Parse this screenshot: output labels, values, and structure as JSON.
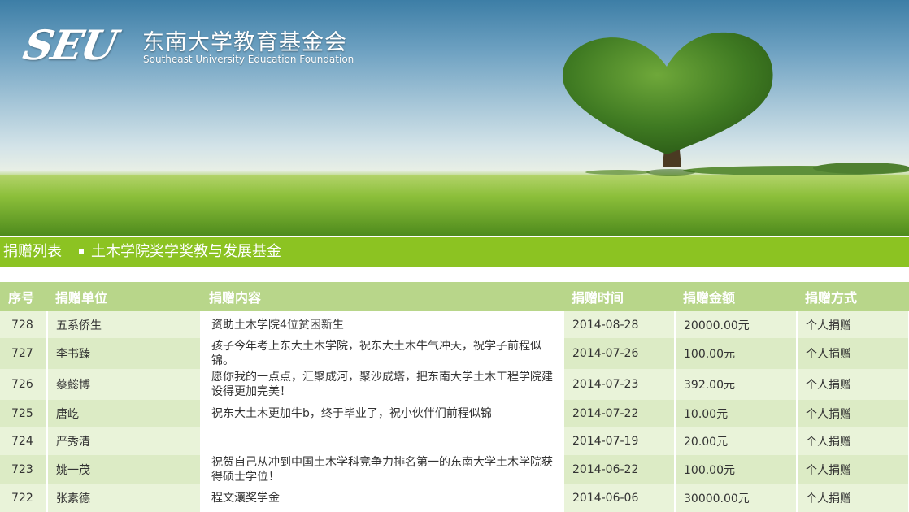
{
  "header": {
    "logo_mark": "SEU",
    "name_cn": "东南大学教育基金会",
    "name_en": "Southeast University Education Foundation"
  },
  "title_bar": {
    "section": "捐赠列表",
    "fund": "土木学院奖学奖教与发展基金"
  },
  "table": {
    "columns": [
      "序号",
      "捐赠单位",
      "捐赠内容",
      "捐赠时间",
      "捐赠金额",
      "捐赠方式"
    ],
    "rows": [
      {
        "no": "728",
        "donor": "五系侨生",
        "content": "资助土木学院4位贫困新生",
        "date": "2014-08-28",
        "amount": "20000.00元",
        "method": "个人捐赠"
      },
      {
        "no": "727",
        "donor": "李书臻",
        "content": "孩子今年考上东大土木学院，祝东大土木牛气冲天，祝学子前程似锦。",
        "date": "2014-07-26",
        "amount": "100.00元",
        "method": "个人捐赠"
      },
      {
        "no": "726",
        "donor": "蔡懿博",
        "content": "愿你我的一点点，汇聚成河，聚沙成塔，把东南大学土木工程学院建设得更加完美！",
        "date": "2014-07-23",
        "amount": "392.00元",
        "method": "个人捐赠"
      },
      {
        "no": "725",
        "donor": "唐屹",
        "content": "祝东大土木更加牛b，终于毕业了，祝小伙伴们前程似锦",
        "date": "2014-07-22",
        "amount": "10.00元",
        "method": "个人捐赠"
      },
      {
        "no": "724",
        "donor": "严秀清",
        "content": "",
        "date": "2014-07-19",
        "amount": "20.00元",
        "method": "个人捐赠"
      },
      {
        "no": "723",
        "donor": "姚一茂",
        "content": "祝贺自己从冲到中国土木学科竞争力排名第一的东南大学土木学院获得硕士学位！",
        "date": "2014-06-22",
        "amount": "100.00元",
        "method": "个人捐赠"
      },
      {
        "no": "722",
        "donor": "张素德",
        "content": "程文瀼奖学金",
        "date": "2014-06-06",
        "amount": "30000.00元",
        "method": "个人捐赠"
      }
    ]
  },
  "colors": {
    "title_bar": "#8cc322",
    "header_row": "#b8d68a",
    "row_light": "#e9f3d9",
    "row_dark": "#dcebc5"
  }
}
